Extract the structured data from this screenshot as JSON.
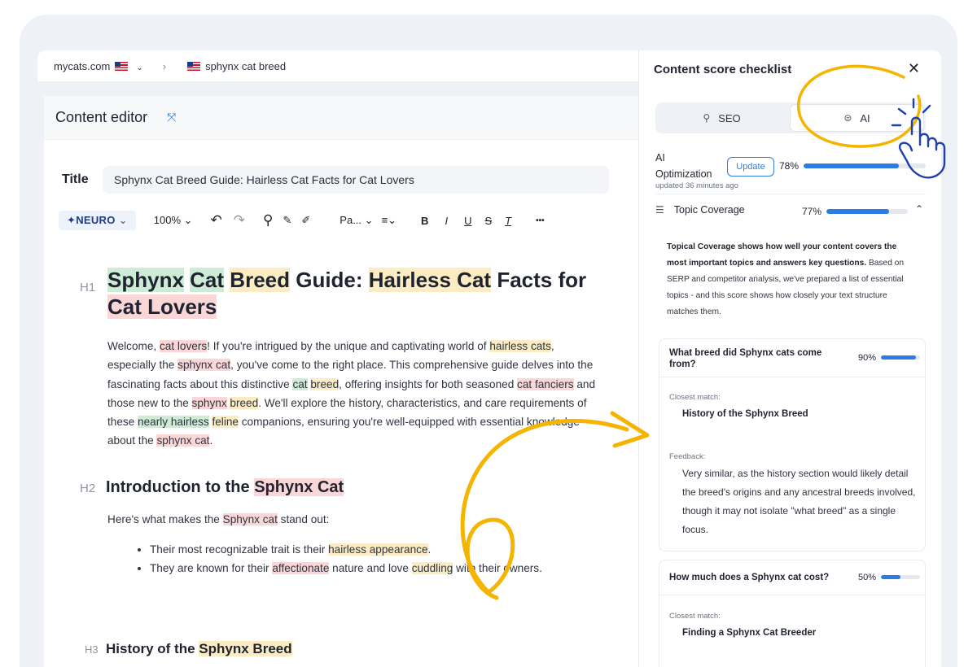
{
  "breadcrumb": {
    "domain": "mycats.com",
    "keyword": "sphynx cat breed"
  },
  "editor": {
    "header_title": "Content editor",
    "title_label": "Title",
    "title_value": "Sphynx Cat Breed Guide: Hairless Cat Facts for Cat Lovers",
    "toolbar": {
      "neuro": "✦NEURO",
      "zoom": "100%",
      "paragraph": "Pa...",
      "bold": "B",
      "italic": "I",
      "underline": "U",
      "strike": "S",
      "clear": "T",
      "more": "•••"
    },
    "h1_tag": "H1",
    "h2_tag": "H2",
    "h3_tag": "H3",
    "intro": "Here's what makes the",
    "intro_word": "Sphynx cat",
    "intro_end": "stand out:",
    "h3_text": "History of the",
    "h3_hl": "Sphynx Breed"
  },
  "panel": {
    "title": "Content score checklist",
    "tabs": [
      {
        "label": "SEO",
        "icon": "search-icon",
        "active": false
      },
      {
        "label": "AI",
        "icon": "robot-icon",
        "active": true
      }
    ],
    "ai_label_1": "AI",
    "ai_label_2": "Optimization",
    "ai_updated": "updated 36 minutes ago",
    "update_button": "Update",
    "ai_score": "78%",
    "ai_score_value": 78,
    "topic_label": "Topic Coverage",
    "topic_score": "77%",
    "topic_score_value": 77,
    "desc_bold": "Topical Coverage shows how well your content covers the most important topics and answers key questions.",
    "desc_rest": "Based on SERP and competitor analysis, we've prepared a list of essential topics - and this score shows how closely your text structure matches them.",
    "cards": [
      {
        "question": "What breed did Sphynx cats come from?",
        "score": "90%",
        "score_value": 90,
        "closest_label": "Closest match:",
        "closest": "History of the Sphynx Breed",
        "feedback_label": "Feedback:",
        "feedback": "Very similar, as the history section would likely detail the breed's origins and any ancestral breeds involved, though it may not isolate \"what breed\" as a single focus."
      },
      {
        "question": "How much does a Sphynx cat cost?",
        "score": "50%",
        "score_value": 50,
        "closest_label": "Closest match:",
        "closest": "Finding a Sphynx Cat Breeder"
      }
    ]
  },
  "colors": {
    "accent": "#2d7be5",
    "highlight_green": "#cdebd5",
    "highlight_yellow": "#fbecc4",
    "highlight_red": "#fbd6d6",
    "annotation_yellow": "#f4b400"
  }
}
